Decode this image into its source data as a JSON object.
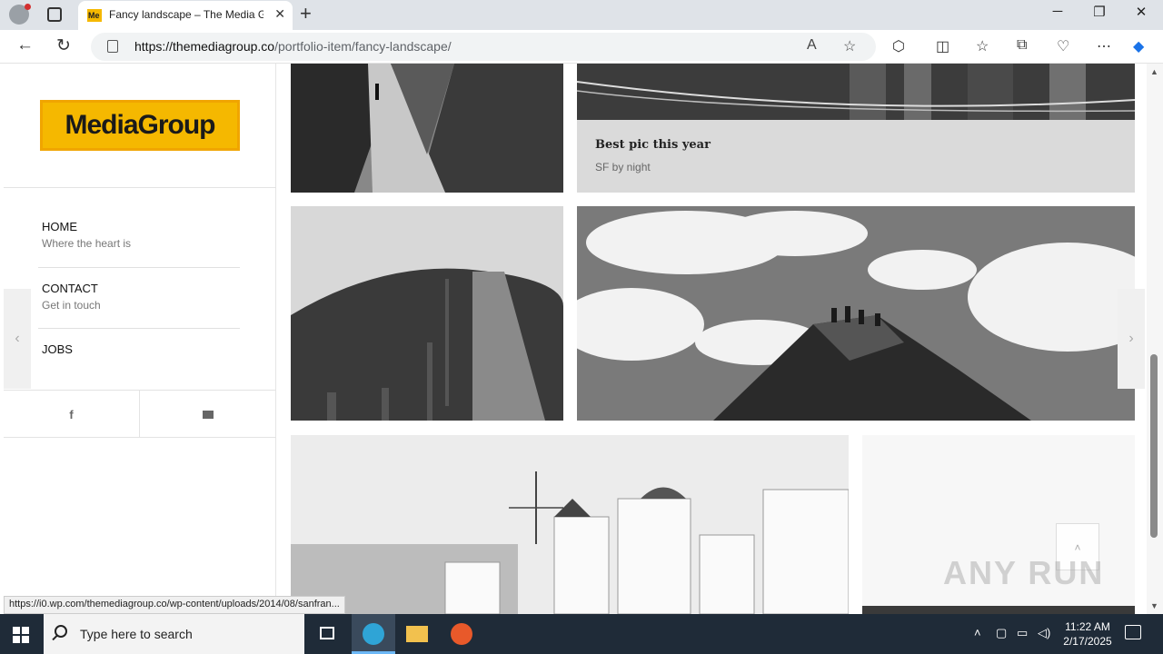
{
  "browser": {
    "tab_title": "Fancy landscape – The Media Gro",
    "tab_favicon_text": "Me",
    "url_domain": "https://themediagroup.co",
    "url_path": "/portfolio-item/fancy-landscape/",
    "status_url": "https://i0.wp.com/themediagroup.co/wp-content/uploads/2014/08/sanfran..."
  },
  "sidebar": {
    "logo_text": "MediaGroup",
    "menu": [
      {
        "label": "HOME",
        "sub": "Where the heart is"
      },
      {
        "label": "CONTACT",
        "sub": "Get in touch"
      },
      {
        "label": "JOBS",
        "sub": ""
      }
    ],
    "social": {
      "facebook_glyph": "f"
    }
  },
  "portfolio": {
    "featured_title": "Best pic this year",
    "featured_subtitle": "SF by night"
  },
  "watermark": "ANY RUN",
  "taskbar": {
    "search_placeholder": "Type here to search",
    "time": "11:22 AM",
    "date": "2/17/2025"
  },
  "colors": {
    "brand_yellow": "#f5b800",
    "taskbar_bg": "#1f2b38"
  }
}
